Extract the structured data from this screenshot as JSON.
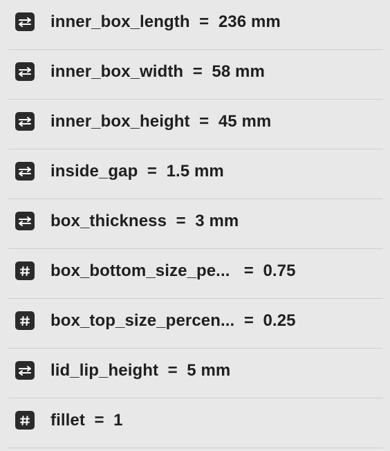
{
  "parameters": [
    {
      "name": "inner_box_length",
      "separator": "  =  ",
      "value": "236 mm",
      "icon": "length-arrows-icon"
    },
    {
      "name": "inner_box_width",
      "separator": "  =  ",
      "value": "58 mm",
      "icon": "length-arrows-icon"
    },
    {
      "name": "inner_box_height",
      "separator": "  =  ",
      "value": "45 mm",
      "icon": "length-arrows-icon"
    },
    {
      "name": "inside_gap",
      "separator": "  =  ",
      "value": "1.5 mm",
      "icon": "length-arrows-icon"
    },
    {
      "name": "box_thickness",
      "separator": "  =  ",
      "value": "3 mm",
      "icon": "length-arrows-icon"
    },
    {
      "name": "box_bottom_size_pe...",
      "separator": "   =  ",
      "value": "0.75",
      "icon": "number-hash-icon"
    },
    {
      "name": "box_top_size_percen...",
      "separator": "  =  ",
      "value": "0.25",
      "icon": "number-hash-icon"
    },
    {
      "name": "lid_lip_height",
      "separator": "  =  ",
      "value": "5 mm",
      "icon": "length-arrows-icon"
    },
    {
      "name": "fillet",
      "separator": "  =  ",
      "value": "1",
      "icon": "number-hash-icon"
    }
  ],
  "colors": {
    "background": "#e8e8e8",
    "divider": "#cdcdcd",
    "icon_bg": "#2b2b2b",
    "icon_fg": "#ffffff",
    "text": "#1f1f1f"
  }
}
